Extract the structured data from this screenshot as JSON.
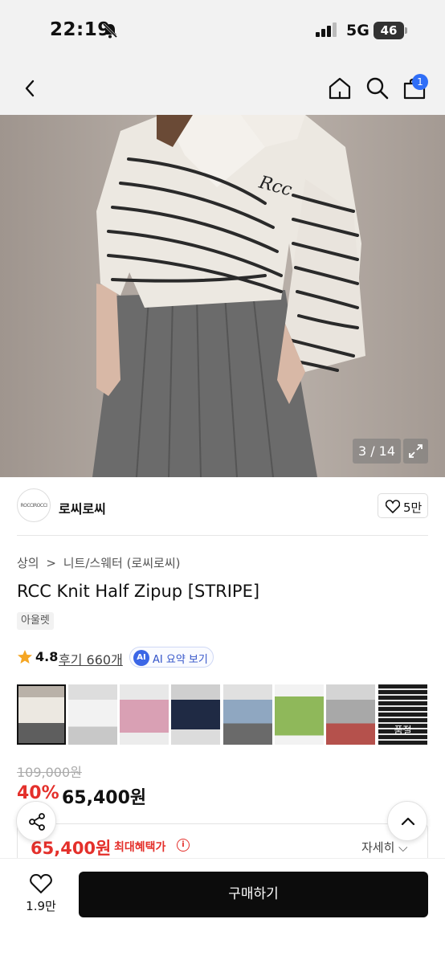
{
  "status_bar": {
    "time": "22:19",
    "network": "5G",
    "battery": "46"
  },
  "navbar": {
    "cart_badge": "1"
  },
  "gallery": {
    "counter": "3 / 14"
  },
  "brand": {
    "logo_text": "ROCCIROCCI",
    "name": "로씨로씨",
    "like_count": "5만"
  },
  "breadcrumb": {
    "level1": "상의",
    "sep": ">",
    "level2": "니트/스웨터 (로씨로씨)"
  },
  "product": {
    "title": "RCC Knit Half Zipup [STRIPE]",
    "tag": "아울렛"
  },
  "rating": {
    "score": "4.8",
    "reviews": "후기 660개",
    "ai_badge": "AI",
    "ai_label": "AI 요약 보기"
  },
  "color_options": {
    "sold_out_label": "품절"
  },
  "price": {
    "original": "109,000원",
    "discount": "40%",
    "sale": "65,400원"
  },
  "benefit": {
    "price": "65,400원",
    "label": "최대혜택가",
    "info": "i",
    "detail": "자세히 ⌵"
  },
  "bottom": {
    "wish_count": "1.9만",
    "buy_label": "구매하기"
  },
  "colors": {
    "accent_red": "#e4302b",
    "badge_blue": "#2f6ef7",
    "buy_black": "#0c0c0c"
  }
}
